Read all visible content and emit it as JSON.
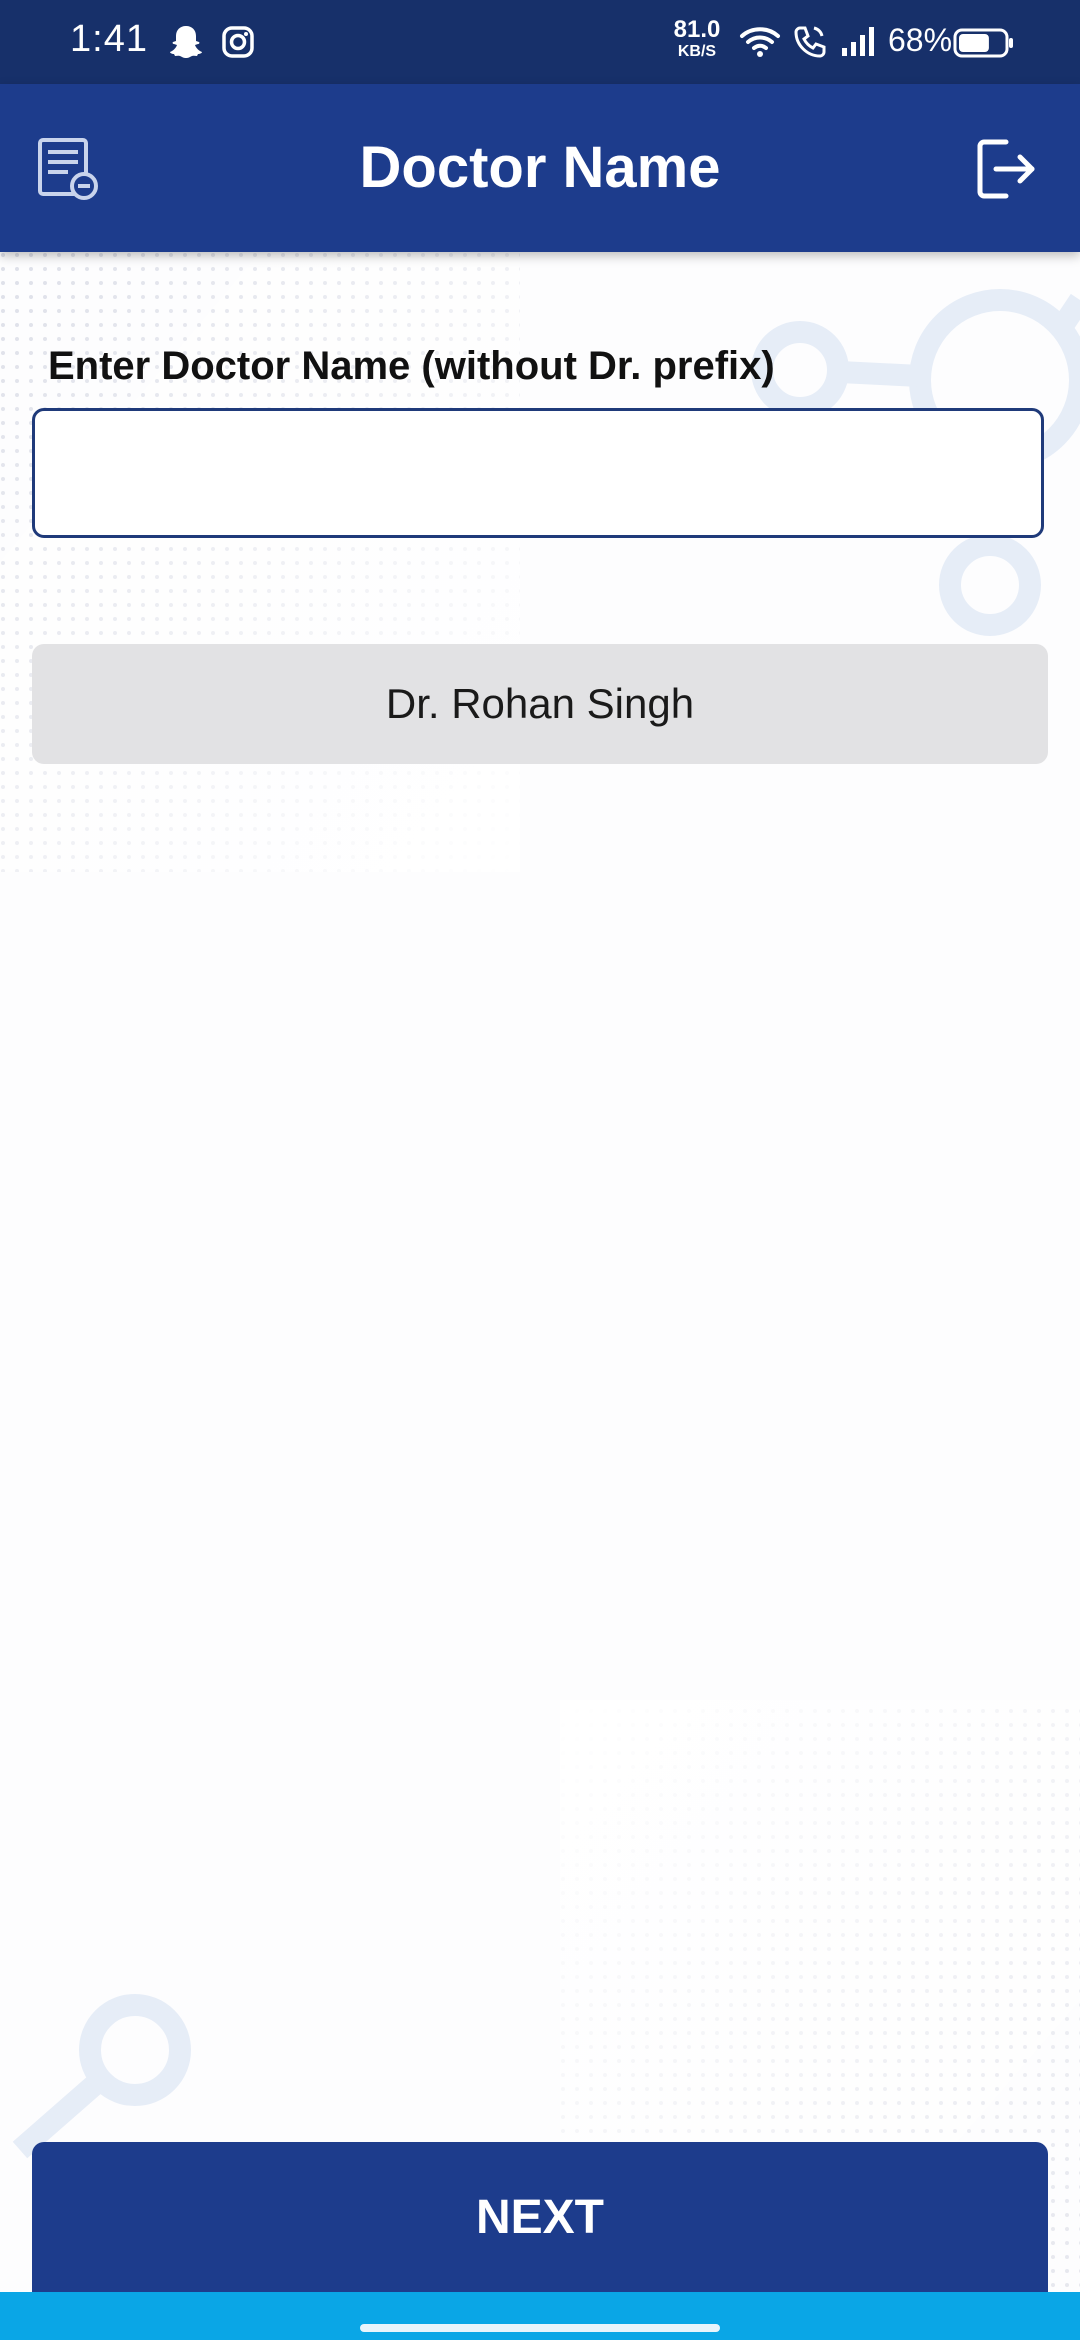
{
  "status_bar": {
    "time": "1:41",
    "net_speed_value": "81.0",
    "net_speed_unit": "KB/S",
    "battery_percent": "68%",
    "battery_level": 0.68,
    "icons": [
      "snapchat-icon",
      "instagram-icon",
      "wifi-icon",
      "wifi-call-icon",
      "signal-icon",
      "battery-icon"
    ]
  },
  "app_bar": {
    "title": "Doctor Name",
    "left_icon": "report-icon",
    "right_icon": "logout-icon"
  },
  "form": {
    "label": "Enter Doctor Name (without Dr. prefix)",
    "input_value": "",
    "input_placeholder": ""
  },
  "suggestions": [
    {
      "label": "Dr. Rohan Singh"
    }
  ],
  "footer": {
    "next_label": "NEXT"
  },
  "colors": {
    "status_bar": "#17306a",
    "app_bar": "#1d3c8c",
    "input_border": "#1f3a7a",
    "suggestion_bg": "#e2e2e4",
    "nav_bar": "#0aa6e6"
  }
}
